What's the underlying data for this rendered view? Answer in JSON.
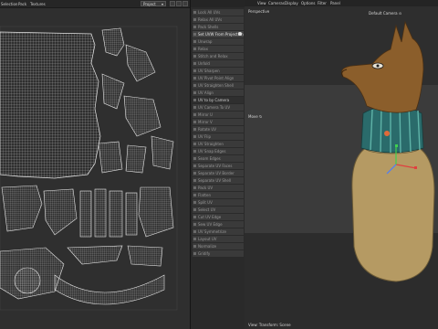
{
  "uv_editor": {
    "menus": [
      "Selection",
      "Pack",
      "Textures"
    ],
    "projection_select": "Project",
    "dropdown_arrow": "▾"
  },
  "tools": {
    "items": [
      {
        "label": "Lock All UVs",
        "icon": "lock-icon"
      },
      {
        "label": "Relax All UVs",
        "icon": "relax-icon"
      },
      {
        "label": "Pack Shells",
        "icon": "pack-icon"
      },
      {
        "label": "Set UVW From Projection",
        "icon": "projection-icon",
        "checked": true
      },
      {
        "label": "Unwrap",
        "icon": "unwrap-icon"
      },
      {
        "label": "Relax",
        "icon": "relax-icon"
      },
      {
        "label": "Stitch and Relax",
        "icon": "stitch-icon"
      },
      {
        "label": "Unfold",
        "icon": "unfold-icon"
      },
      {
        "label": "UV Sharpen",
        "icon": "sharpen-icon"
      },
      {
        "label": "UV Pivot Point Align",
        "icon": "align-icon"
      },
      {
        "label": "UV Straighten Shell",
        "icon": "straighten-icon"
      },
      {
        "label": "UV Align",
        "icon": "align-icon"
      },
      {
        "label": "UV to by Camera",
        "icon": "camera-icon",
        "section": true
      },
      {
        "label": "UV Camera To UV",
        "icon": "camera-icon"
      },
      {
        "label": "Mirror U",
        "icon": "mirror-icon"
      },
      {
        "label": "Mirror V",
        "icon": "mirror-icon"
      },
      {
        "label": "Rotate UV",
        "icon": "rotate-icon"
      },
      {
        "label": "UV Flip",
        "icon": "flip-icon"
      },
      {
        "label": "UV Straighten",
        "icon": "straighten-icon"
      },
      {
        "label": "UV Snap Edges",
        "icon": "snap-icon"
      },
      {
        "label": "Seam Edges",
        "icon": "seam-icon"
      },
      {
        "label": "Separate UV Faces",
        "icon": "separate-icon"
      },
      {
        "label": "Separate UV Border",
        "icon": "separate-icon"
      },
      {
        "label": "Separate UV Shell",
        "icon": "separate-icon"
      },
      {
        "label": "Pack UV",
        "icon": "pack-icon"
      },
      {
        "label": "Flatten",
        "icon": "flatten-icon"
      },
      {
        "label": "Split UV",
        "icon": "split-icon"
      },
      {
        "label": "Select UV",
        "icon": "select-icon"
      },
      {
        "label": "Cut UV Edge",
        "icon": "cut-icon"
      },
      {
        "label": "Sew UV Edge",
        "icon": "sew-icon"
      },
      {
        "label": "UV Symmetrize",
        "icon": "symmetry-icon"
      },
      {
        "label": "Layout UV",
        "icon": "layout-icon"
      },
      {
        "label": "Normalize",
        "icon": "normalize-icon"
      },
      {
        "label": "Gridify",
        "icon": "grid-icon"
      }
    ]
  },
  "viewport": {
    "menus": [
      "View",
      "Cameras",
      "Display",
      "Options",
      "Filter",
      "Panel"
    ],
    "label_top_left": "Perspective",
    "camera_label": "Default Camera ⊙",
    "move_label": "Move ↻",
    "footer": "View: Transform: Scene"
  },
  "colors": {
    "wire": "#cfcfcf",
    "uv_bg": "#2f2f2f",
    "jar_body": "#b59a63",
    "jackal_head": "#8b5e2b",
    "teal_collar": "#2a6b6b",
    "gizmo_red": "#e0403f",
    "gizmo_green": "#3fcf4f",
    "gizmo_blue": "#4a7cff"
  }
}
